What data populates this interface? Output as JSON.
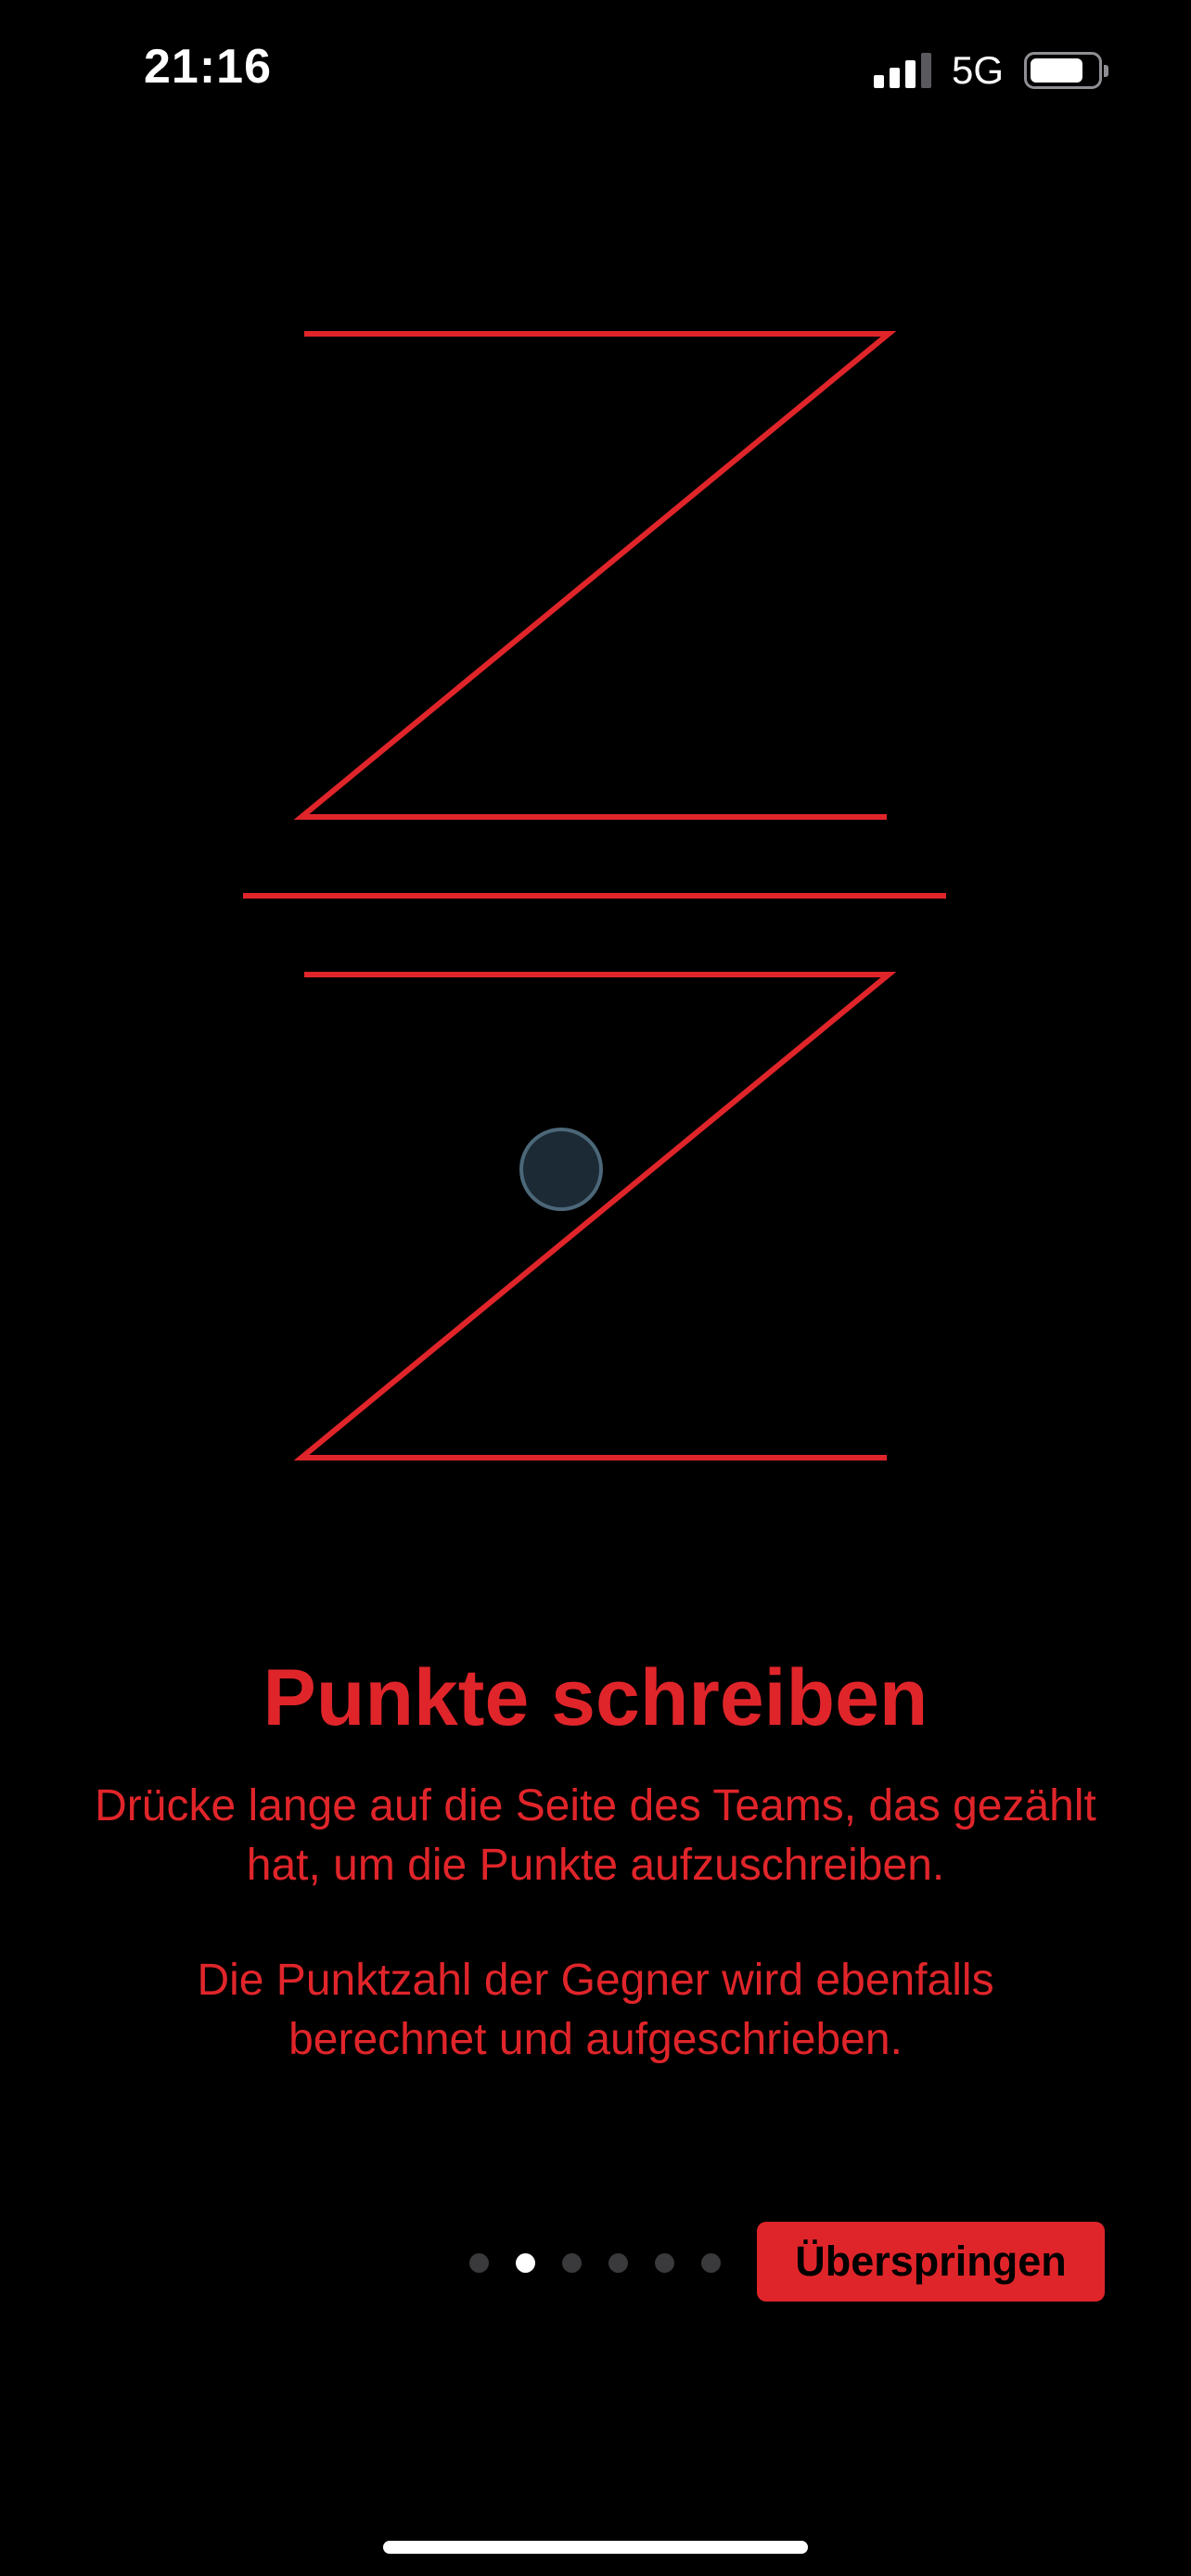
{
  "status_bar": {
    "time": "21:16",
    "network": "5G",
    "battery_level": 0.8,
    "signal_bars": 3,
    "signal_bars_total": 4
  },
  "colors": {
    "accent": "#e0252a",
    "background": "#000000",
    "touch_dot": "#1c2a36",
    "dot_inactive": "#3a3a3c",
    "dot_active": "#ffffff"
  },
  "icons": {
    "signal": "cellular-signal-icon",
    "battery": "battery-icon",
    "illustration": "scoreboard-z-illustration",
    "touch": "touch-indicator-icon"
  },
  "onboarding": {
    "title": "Punkte schreiben",
    "paragraph_1": "Drücke lange auf die Seite des Teams, das gezählt hat, um die Punkte aufzuschreiben.",
    "paragraph_2": "Die Punktzahl der Gegner wird ebenfalls berechnet und aufgeschrieben.",
    "page_count": 6,
    "current_page": 2,
    "skip_label": "Überspringen"
  }
}
